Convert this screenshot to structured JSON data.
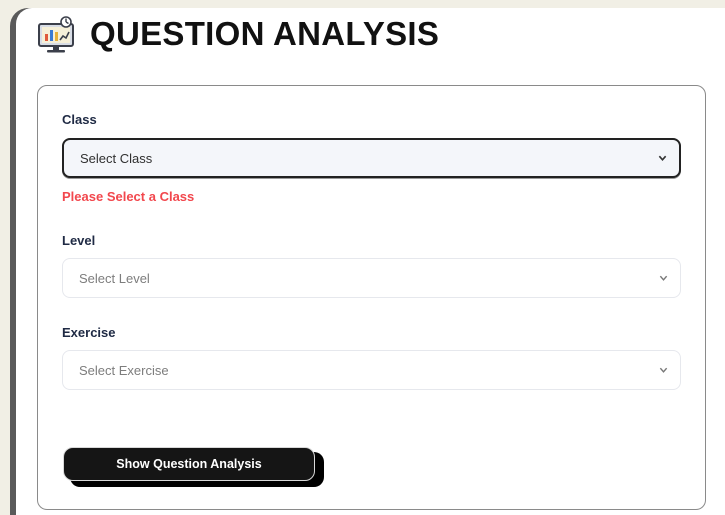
{
  "header": {
    "icon": "analytics-monitor-icon",
    "title": "QUESTION ANALYSIS"
  },
  "form": {
    "class_label": "Class",
    "class_select": {
      "value": "Select Class"
    },
    "class_error": "Please Select a Class",
    "level_label": "Level",
    "level_select": {
      "value": "Select Level"
    },
    "exercise_label": "Exercise",
    "exercise_select": {
      "value": "Select Exercise"
    },
    "submit_label": "Show Question Analysis"
  },
  "colors": {
    "page_bg": "#f1efe5",
    "error": "#f2474d",
    "button_bg": "#151515",
    "label": "#1f2a44"
  }
}
